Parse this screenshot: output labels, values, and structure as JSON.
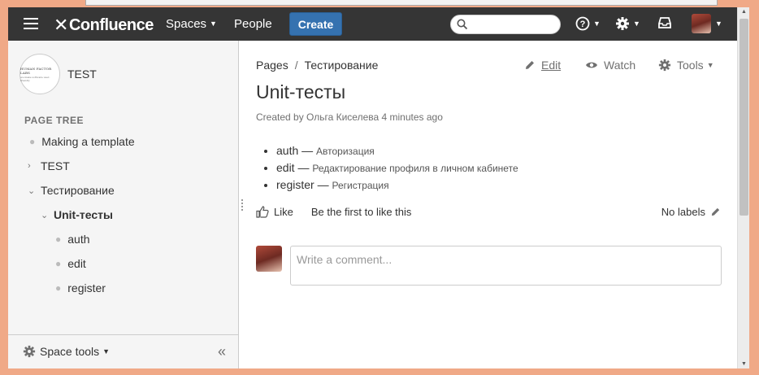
{
  "header": {
    "logo": "Confluence",
    "spaces": "Spaces",
    "people": "People",
    "create": "Create",
    "search_placeholder": ""
  },
  "sidebar": {
    "space_logo_line1": "HUMAN FACTOR LABS",
    "space_logo_line2": "we make software user-friendly",
    "space_name": "TEST",
    "page_tree_title": "PAGE TREE",
    "tree": [
      {
        "label": "Making a template"
      },
      {
        "label": "TEST"
      },
      {
        "label": "Тестирование"
      },
      {
        "label": "Unit-тесты"
      },
      {
        "label": "auth"
      },
      {
        "label": "edit"
      },
      {
        "label": "register"
      }
    ],
    "space_tools": "Space tools",
    "collapse": "«"
  },
  "main": {
    "breadcrumb": [
      "Pages",
      "/",
      "Тестирование"
    ],
    "actions": {
      "edit": "Edit",
      "watch": "Watch",
      "tools": "Tools"
    },
    "title": "Unit-тесты",
    "meta": "Created by Ольга Киселева 4 minutes ago",
    "children": [
      {
        "name": "auth",
        "sep": " — ",
        "desc": "Авторизация"
      },
      {
        "name": "edit",
        "sep": " — ",
        "desc": "Редактирование профиля в личном кабинете"
      },
      {
        "name": "register",
        "sep": " — ",
        "desc": "Регистрация"
      }
    ],
    "like": "Like",
    "like_prompt": "Be the first to like this",
    "no_labels": "No labels",
    "comment_placeholder": "Write a comment..."
  },
  "colors": {
    "header_bg": "#353535",
    "create_button": "#3572b0",
    "window_frame": "#f0a987"
  }
}
